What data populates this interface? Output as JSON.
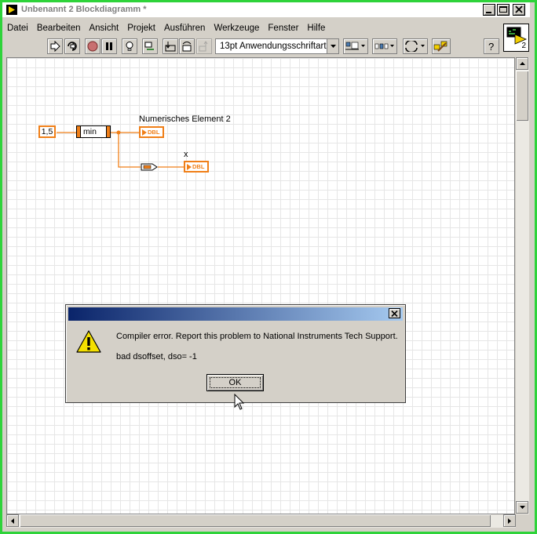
{
  "window": {
    "title": "Unbenannt 2 Blockdiagramm *",
    "border_color": "#2ed33a"
  },
  "menu": [
    {
      "label": "Datei"
    },
    {
      "label": "Bearbeiten"
    },
    {
      "label": "Ansicht"
    },
    {
      "label": "Projekt"
    },
    {
      "label": "Ausführen"
    },
    {
      "label": "Werkzeuge"
    },
    {
      "label": "Fenster"
    },
    {
      "label": "Hilfe"
    }
  ],
  "toolbar": {
    "buttons": [
      "run-icon",
      "run-continuously-icon",
      "abort-icon",
      "pause-icon",
      "highlight-execution-icon",
      "retain-wire-values-icon",
      "step-into-icon",
      "step-over-icon",
      "step-out-icon"
    ],
    "font_label": "13pt Anwendungsschriftart",
    "align_icon": "align-objects-icon",
    "distribute_icon": "distribute-objects-icon",
    "reorder_icon": "reorder-icon",
    "cleanup_icon": "cleanup-diagram-icon",
    "help_icon": "context-help-icon"
  },
  "vi_icon": {
    "number": "2"
  },
  "diagram": {
    "constant": "1,5",
    "function": "min",
    "indicator1_label": "Numerisches Element 2",
    "indicator1_type": "DBL",
    "indicator2_label": "x",
    "indicator2_type": "DBL",
    "wire_color": "#f07f18"
  },
  "dialog": {
    "message": "Compiler error.  Report this problem to National Instruments Tech Support.",
    "detail": "bad dsoffset, dso= -1",
    "ok_label": "OK",
    "icon": "warning-icon"
  }
}
